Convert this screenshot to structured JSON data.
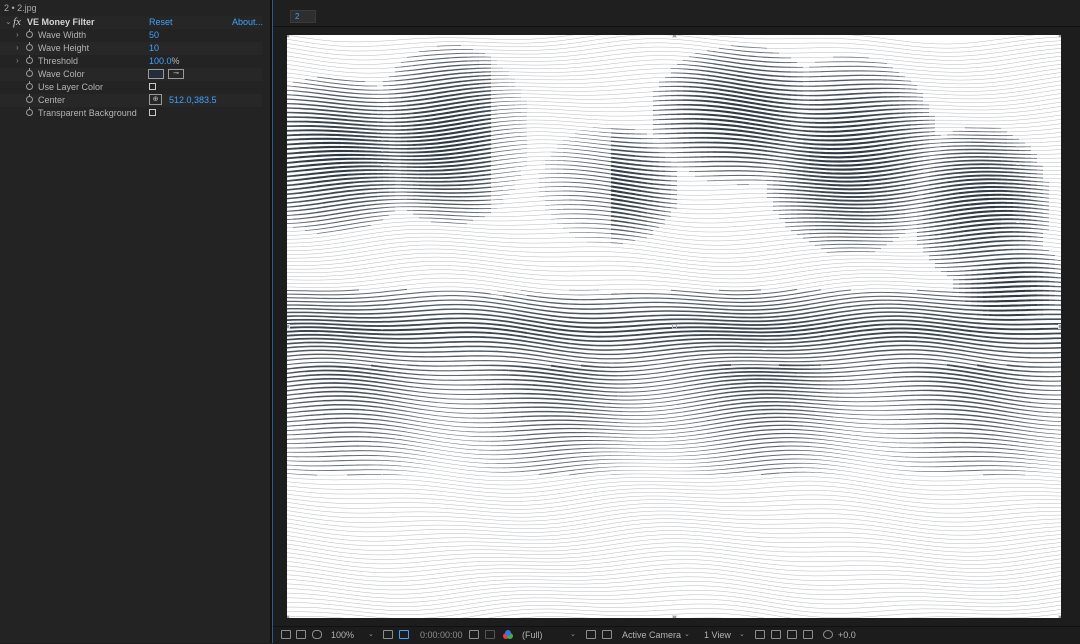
{
  "effect_controls": {
    "title": "2 • 2.jpg",
    "effect": {
      "fx_icon": "fx",
      "name": "VE Money Filter",
      "reset_label": "Reset",
      "about_label": "About..."
    },
    "properties": [
      {
        "label": "Wave Width",
        "value": "50"
      },
      {
        "label": "Wave Height",
        "value": "10"
      },
      {
        "label": "Threshold",
        "value": "100.0",
        "unit": "%"
      },
      {
        "label": "Wave Color",
        "color": "#242e3a"
      },
      {
        "label": "Use Layer Color",
        "checked": false
      },
      {
        "label": "Center",
        "value": "512.0,383.5"
      },
      {
        "label": "Transparent Background",
        "checked": false
      }
    ]
  },
  "viewer": {
    "tab_label": "2",
    "ink_color": "#1e2a36",
    "footer": {
      "zoom": "100%",
      "timecode": "0:00:00:00",
      "resolution": "(Full)",
      "camera": "Active Camera",
      "views": "1 View",
      "exposure": "+0.0"
    }
  },
  "icons": [
    "twirl-arrow-icon",
    "stopwatch-icon",
    "eyedropper-icon",
    "crosshair-icon",
    "snapshot-icon",
    "color-channel-icon",
    "grid-icon"
  ]
}
